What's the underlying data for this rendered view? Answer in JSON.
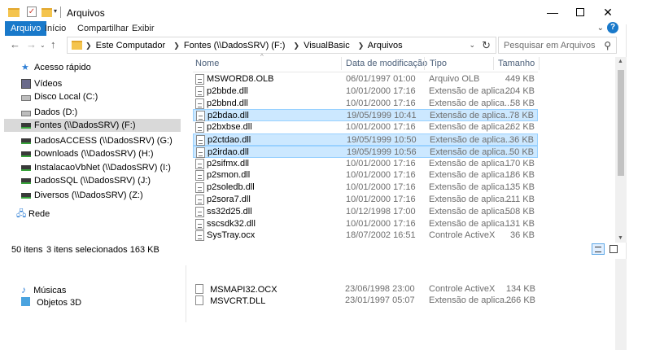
{
  "window": {
    "title": "Arquivos",
    "ribbon_tabs": [
      "Arquivo",
      "Início",
      "Compartilhar",
      "Exibir"
    ]
  },
  "address": {
    "breadcrumbs": [
      "Este Computador",
      "Fontes (\\\\DadosSRV) (F:)",
      "VisualBasic",
      "Arquivos"
    ],
    "search_placeholder": "Pesquisar em Arquivos"
  },
  "nav_pane": {
    "items": [
      {
        "label": "Acesso rápido",
        "icon": "star-icon"
      },
      {
        "label": "Vídeos",
        "icon": "videos-folder-icon"
      },
      {
        "label": "Disco Local (C:)",
        "icon": "drive-icon"
      },
      {
        "label": "Dados (D:)",
        "icon": "drive-icon"
      },
      {
        "label": "Fontes (\\\\DadosSRV) (F:)",
        "icon": "network-drive-icon",
        "selected": true
      },
      {
        "label": "DadosACCESS (\\\\DadosSRV) (G:)",
        "icon": "network-drive-icon"
      },
      {
        "label": "Downloads (\\\\DadosSRV) (H:)",
        "icon": "network-drive-icon"
      },
      {
        "label": "InstalacaoVbNet (\\\\DadosSRV) (I:)",
        "icon": "network-drive-icon"
      },
      {
        "label": "DadosSQL (\\\\DadosSRV) (J:)",
        "icon": "network-drive-icon"
      },
      {
        "label": "Diversos (\\\\DadosSRV) (Z:)",
        "icon": "network-drive-icon"
      },
      {
        "label": "Rede",
        "icon": "network-icon"
      }
    ]
  },
  "columns": [
    "Nome",
    "Data de modificação",
    "Tipo",
    "Tamanho"
  ],
  "files": [
    {
      "name": "MSWORD8.OLB",
      "date": "06/01/1997 01:00",
      "type": "Arquivo OLB",
      "size": "449 KB"
    },
    {
      "name": "p2bbde.dll",
      "date": "10/01/2000 17:16",
      "type": "Extensão de aplica...",
      "size": "204 KB"
    },
    {
      "name": "p2bbnd.dll",
      "date": "10/01/2000 17:16",
      "type": "Extensão de aplica...",
      "size": "58 KB"
    },
    {
      "name": "p2bdao.dll",
      "date": "19/05/1999 10:41",
      "type": "Extensão de aplica...",
      "size": "78 KB",
      "selected": true
    },
    {
      "name": "p2bxbse.dll",
      "date": "10/01/2000 17:16",
      "type": "Extensão de aplica...",
      "size": "262 KB"
    },
    {
      "name": "p2ctdao.dll",
      "date": "19/05/1999 10:50",
      "type": "Extensão de aplica...",
      "size": "36 KB",
      "selected": true
    },
    {
      "name": "p2irdao.dll",
      "date": "19/05/1999 10:56",
      "type": "Extensão de aplica...",
      "size": "50 KB",
      "selected": true
    },
    {
      "name": "p2sifmx.dll",
      "date": "10/01/2000 17:16",
      "type": "Extensão de aplica...",
      "size": "170 KB"
    },
    {
      "name": "p2smon.dll",
      "date": "10/01/2000 17:16",
      "type": "Extensão de aplica...",
      "size": "186 KB"
    },
    {
      "name": "p2soledb.dll",
      "date": "10/01/2000 17:16",
      "type": "Extensão de aplica...",
      "size": "135 KB"
    },
    {
      "name": "p2sora7.dll",
      "date": "10/01/2000 17:16",
      "type": "Extensão de aplica...",
      "size": "211 KB"
    },
    {
      "name": "ss32d25.dll",
      "date": "10/12/1998 17:00",
      "type": "Extensão de aplica...",
      "size": "508 KB"
    },
    {
      "name": "sscsdk32.dll",
      "date": "10/01/2000 17:16",
      "type": "Extensão de aplica...",
      "size": "131 KB"
    },
    {
      "name": "SysTray.ocx",
      "date": "18/07/2002 16:51",
      "type": "Controle ActiveX",
      "size": "36 KB"
    }
  ],
  "status": {
    "count": "50 itens",
    "selection": "3 itens selecionados  163 KB"
  },
  "background_window": {
    "nav_items": [
      {
        "label": "Músicas",
        "icon": "music-icon"
      },
      {
        "label": "Objetos 3D",
        "icon": "3d-objects-icon"
      }
    ],
    "files": [
      {
        "name": "MSMAPI32.OCX",
        "date": "23/06/1998 23:00",
        "type": "Controle ActiveX",
        "size": "134 KB"
      },
      {
        "name": "MSVCRT.DLL",
        "date": "23/01/1997 05:07",
        "type": "Extensão de aplica...",
        "size": "266 KB"
      }
    ]
  },
  "colors": {
    "accent": "#1979ca",
    "selection": "#cce8ff",
    "selection_border": "#99d1ff",
    "nav_selected": "#d9d9d9"
  }
}
